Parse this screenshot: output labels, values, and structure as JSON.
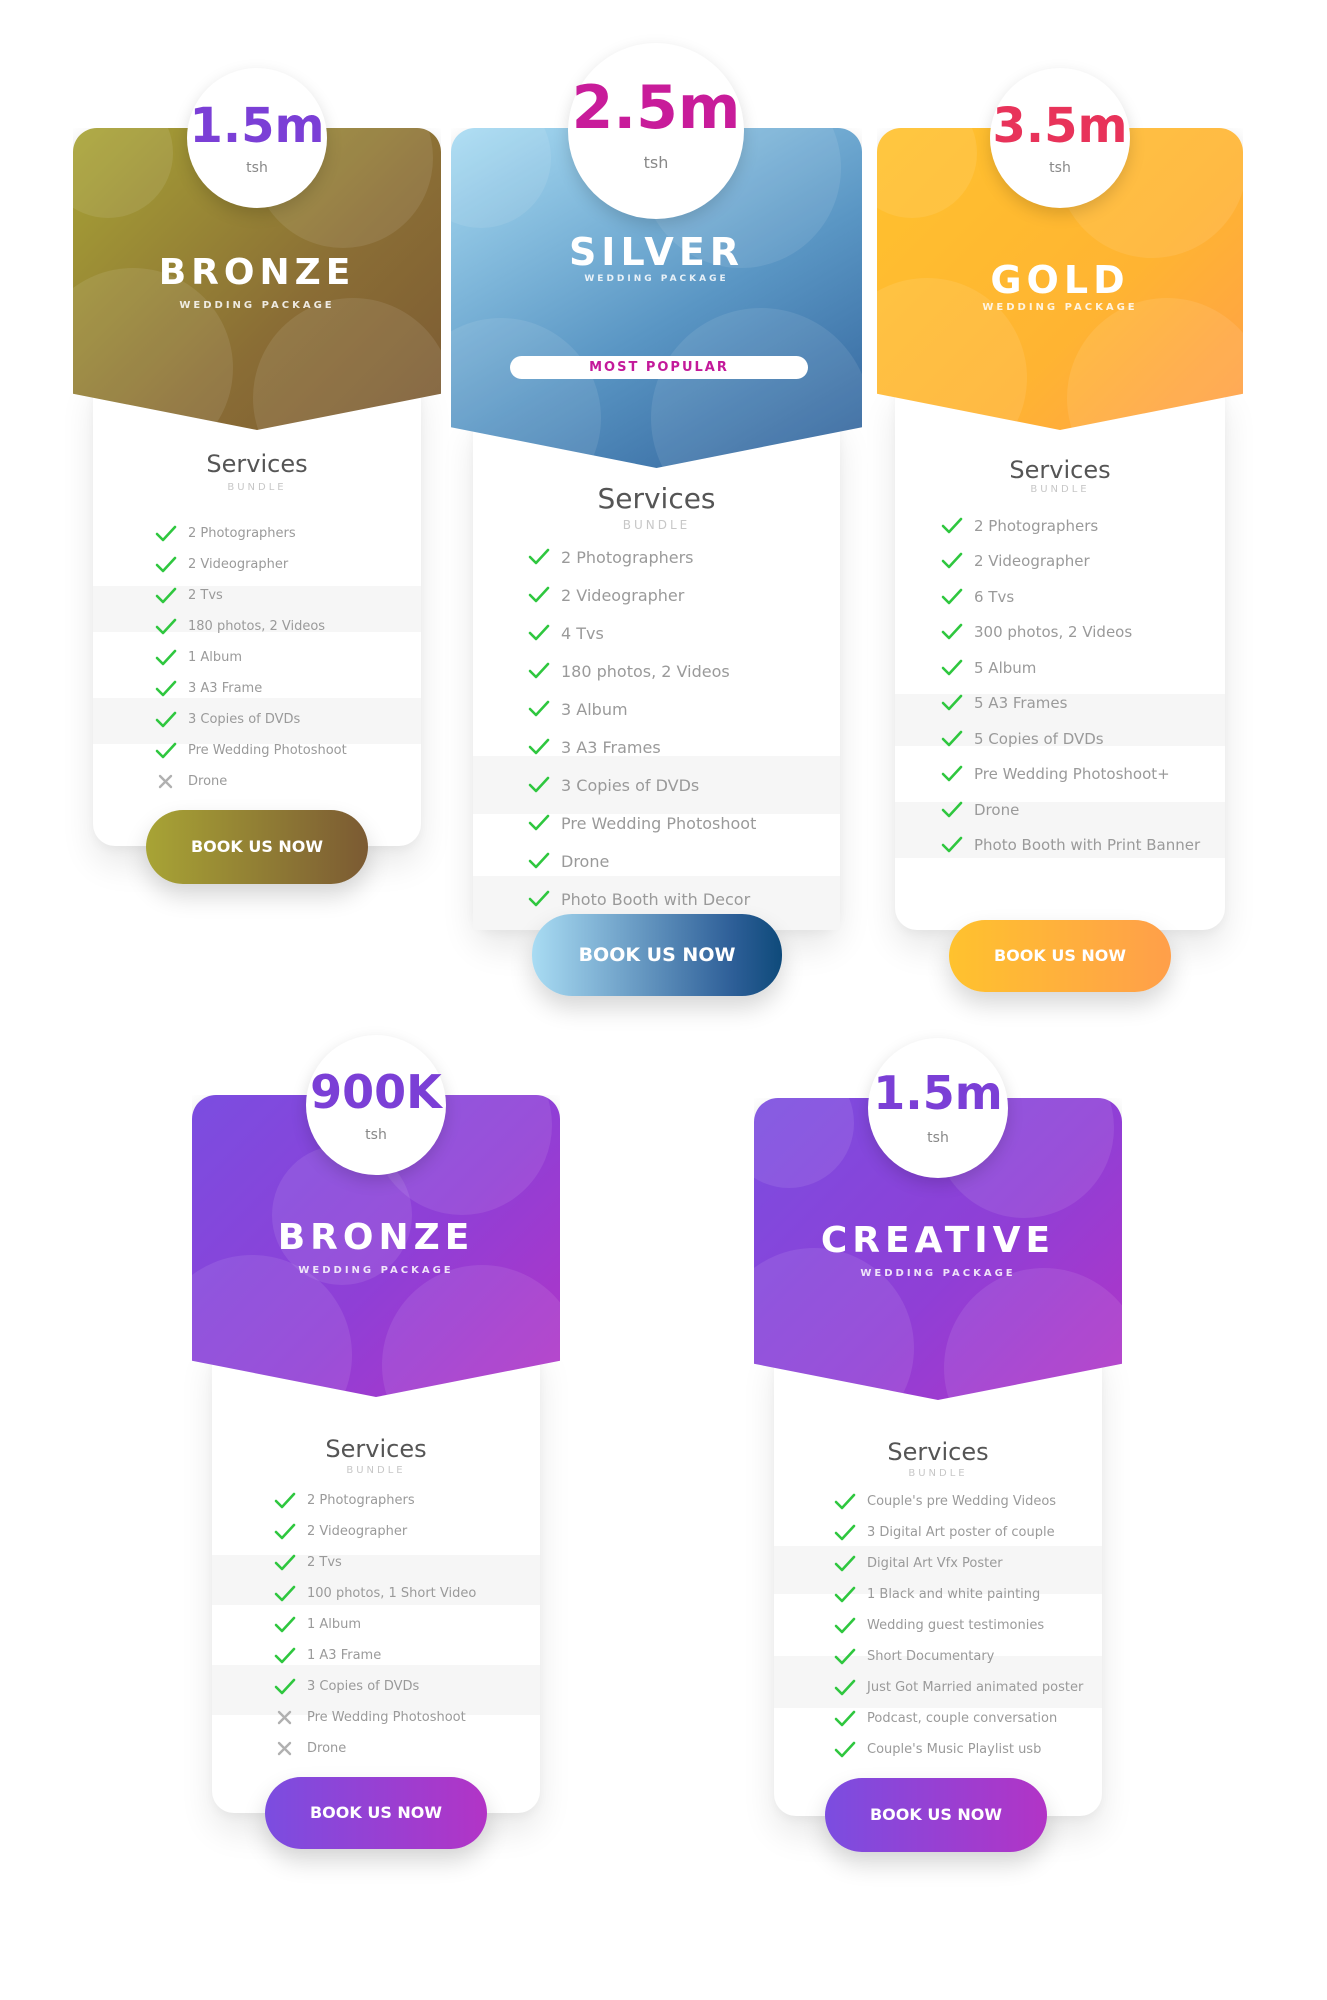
{
  "colors": {
    "check": "#2fc73f",
    "cross": "#b0b0b0"
  },
  "cards": [
    {
      "id": "bronze-top",
      "price": "1.5m",
      "unit": "tsh",
      "title": "BRONZE",
      "subtitle": "WEDDING PACKAGE",
      "services_title": "Services",
      "services_sub": "BUNDLE",
      "button": "BOOK US NOW",
      "price_color": "#7b3fd6",
      "gradient": [
        "#a8a435",
        "#8a6d35",
        "#7b5a33"
      ],
      "features": [
        {
          "label": "2 Photographers",
          "included": true
        },
        {
          "label": "2 Videographer",
          "included": true
        },
        {
          "label": "2 Tvs",
          "included": true
        },
        {
          "label": "180 photos, 2 Videos",
          "included": true
        },
        {
          "label": "1 Album",
          "included": true
        },
        {
          "label": "3 A3 Frame",
          "included": true
        },
        {
          "label": "3 Copies of DVDs",
          "included": true
        },
        {
          "label": "Pre Wedding Photoshoot",
          "included": true
        },
        {
          "label": "Drone",
          "included": false
        }
      ]
    },
    {
      "id": "silver",
      "price": "2.5m",
      "unit": "tsh",
      "title": "SILVER",
      "subtitle": "WEDDING PACKAGE",
      "badge": "MOST POPULAR",
      "services_title": "Services",
      "services_sub": "BUNDLE",
      "button": "BOOK US NOW",
      "price_color": "#c81c9a",
      "gradient": [
        "#a9dcf3",
        "#5a96c4",
        "#2e5f98"
      ],
      "features": [
        {
          "label": "2 Photographers",
          "included": true
        },
        {
          "label": "2 Videographer",
          "included": true
        },
        {
          "label": "4 Tvs",
          "included": true
        },
        {
          "label": "180 photos, 2 Videos",
          "included": true
        },
        {
          "label": "3 Album",
          "included": true
        },
        {
          "label": "3 A3 Frames",
          "included": true
        },
        {
          "label": "3 Copies of DVDs",
          "included": true
        },
        {
          "label": "Pre Wedding Photoshoot",
          "included": true
        },
        {
          "label": "Drone",
          "included": true
        },
        {
          "label": "Photo Booth with Decor",
          "included": true
        }
      ]
    },
    {
      "id": "gold",
      "price": "3.5m",
      "unit": "tsh",
      "title": "GOLD",
      "subtitle": "WEDDING PACKAGE",
      "services_title": "Services",
      "services_sub": "BUNDLE",
      "button": "BOOK US NOW",
      "price_color": "#e8335a",
      "gradient": [
        "#ffc22e",
        "#ffb432",
        "#ff9f4a"
      ],
      "features": [
        {
          "label": "2 Photographers",
          "included": true
        },
        {
          "label": "2 Videographer",
          "included": true
        },
        {
          "label": "6 Tvs",
          "included": true
        },
        {
          "label": "300 photos, 2 Videos",
          "included": true
        },
        {
          "label": "5 Album",
          "included": true
        },
        {
          "label": "5 A3 Frames",
          "included": true
        },
        {
          "label": "5 Copies of DVDs",
          "included": true
        },
        {
          "label": "Pre Wedding Photoshoot+",
          "included": true
        },
        {
          "label": "Drone",
          "included": true
        },
        {
          "label": "Photo Booth with Print Banner",
          "included": true
        }
      ]
    },
    {
      "id": "bronze-bottom",
      "price": "900K",
      "unit": "tsh",
      "title": "BRONZE",
      "subtitle": "WEDDING PACKAGE",
      "services_title": "Services",
      "services_sub": "BUNDLE",
      "button": "BOOK US NOW",
      "price_color": "#7b3fd6",
      "gradient": [
        "#7b4de0",
        "#8f3fd6",
        "#b234c6"
      ],
      "features": [
        {
          "label": "2 Photographers",
          "included": true
        },
        {
          "label": "2 Videographer",
          "included": true
        },
        {
          "label": "2 Tvs",
          "included": true
        },
        {
          "label": "100 photos, 1 Short Video",
          "included": true
        },
        {
          "label": "1 Album",
          "included": true
        },
        {
          "label": "1 A3 Frame",
          "included": true
        },
        {
          "label": "3 Copies of DVDs",
          "included": true
        },
        {
          "label": "Pre Wedding Photoshoot",
          "included": false
        },
        {
          "label": "Drone",
          "included": false
        }
      ]
    },
    {
      "id": "creative",
      "price": "1.5m",
      "unit": "tsh",
      "title": "CREATIVE",
      "subtitle": "WEDDING PACKAGE",
      "services_title": "Services",
      "services_sub": "BUNDLE",
      "button": "BOOK US NOW",
      "price_color": "#7b3fd6",
      "gradient": [
        "#7b4de0",
        "#8f3fd6",
        "#b234c6"
      ],
      "features": [
        {
          "label": "Couple's pre Wedding Videos",
          "included": true
        },
        {
          "label": "3 Digital Art poster of couple",
          "included": true
        },
        {
          "label": "Digital Art Vfx Poster",
          "included": true
        },
        {
          "label": "1 Black and white painting",
          "included": true
        },
        {
          "label": "Wedding guest testimonies",
          "included": true
        },
        {
          "label": "Short Documentary",
          "included": true
        },
        {
          "label": "Just Got Married animated poster",
          "included": true
        },
        {
          "label": "Podcast, couple conversation",
          "included": true
        },
        {
          "label": "Couple's Music Playlist usb",
          "included": true
        }
      ]
    }
  ]
}
